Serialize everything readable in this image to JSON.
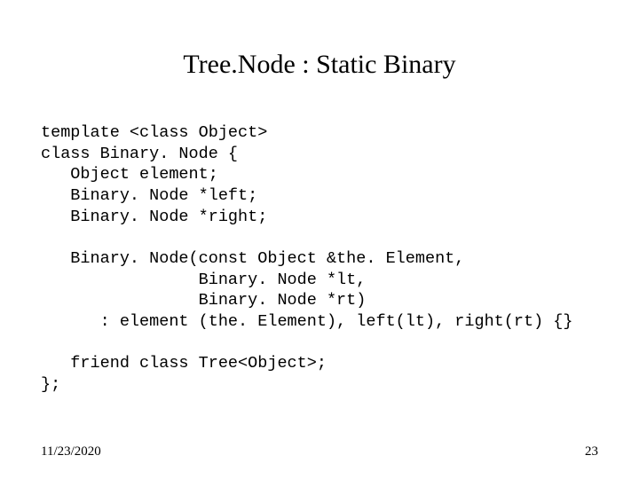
{
  "title": "Tree.Node : Static Binary",
  "code": "template <class Object>\nclass Binary. Node {\n   Object element;\n   Binary. Node *left;\n   Binary. Node *right;\n\n   Binary. Node(const Object &the. Element,\n                Binary. Node *lt,\n                Binary. Node *rt)\n      : element (the. Element), left(lt), right(rt) {}\n\n   friend class Tree<Object>;\n};",
  "footer": {
    "date": "11/23/2020",
    "page": "23"
  }
}
